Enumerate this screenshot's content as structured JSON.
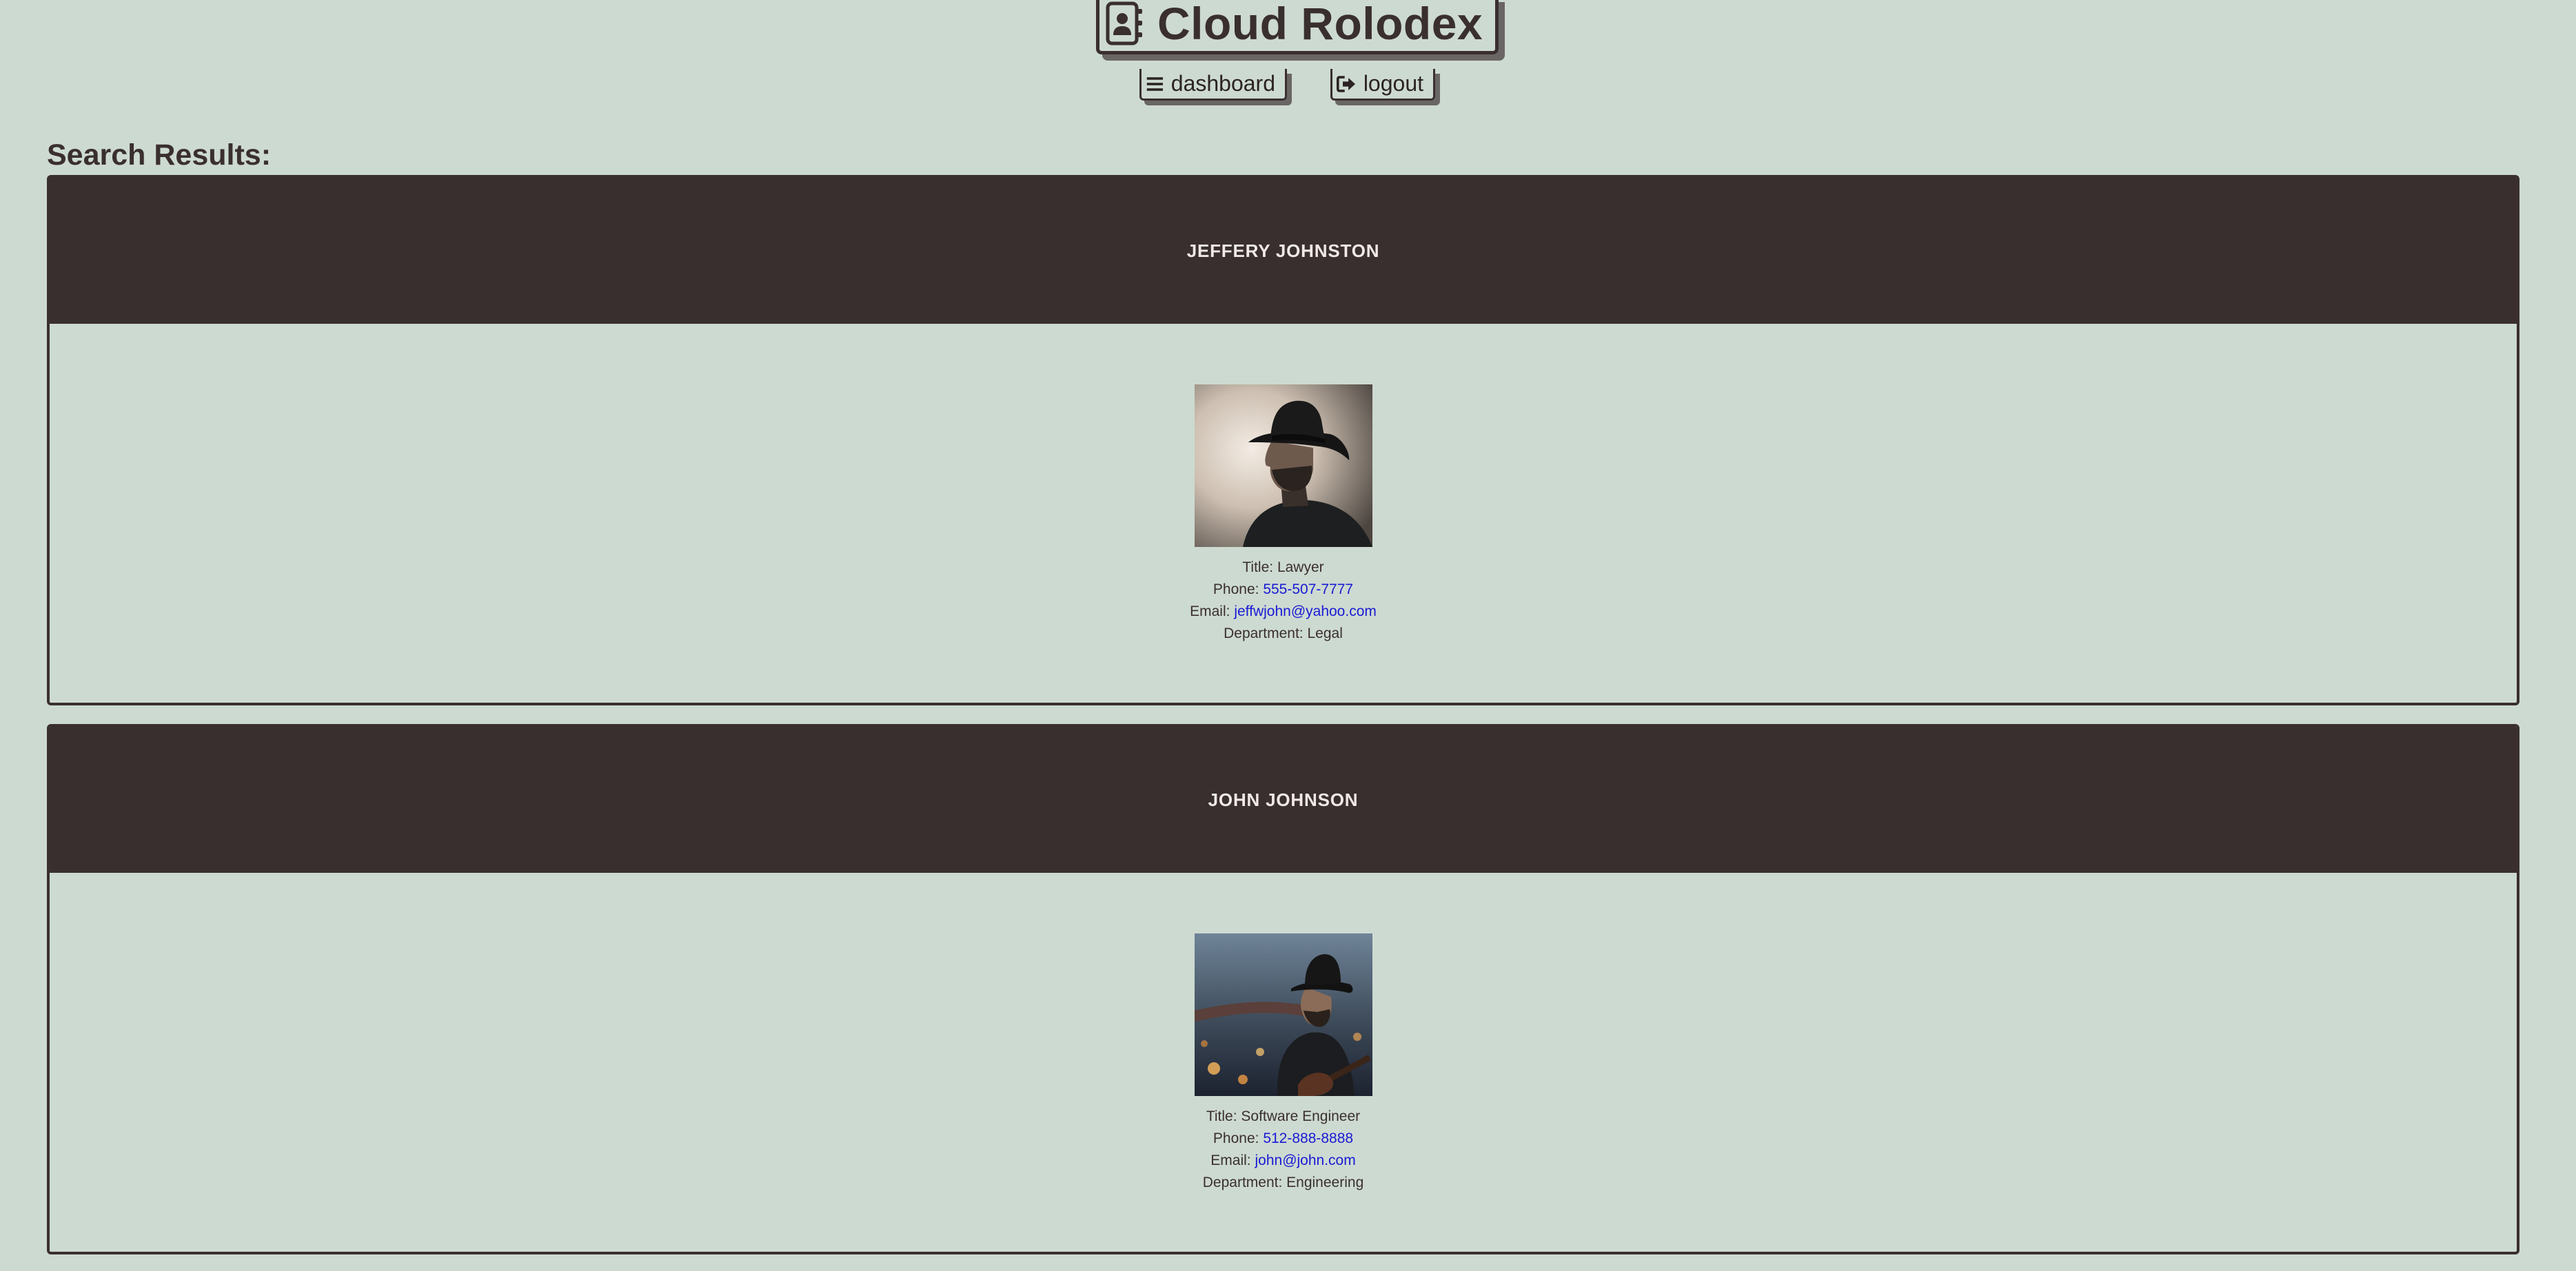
{
  "app": {
    "title": "Cloud Rolodex",
    "icon": "address-book-icon"
  },
  "nav": {
    "dashboard": {
      "label": "dashboard",
      "icon": "bars-icon"
    },
    "logout": {
      "label": "logout",
      "icon": "sign-out-icon"
    }
  },
  "results": {
    "heading": "Search Results:"
  },
  "labels": {
    "title": "Title:",
    "phone": "Phone:",
    "email": "Email:",
    "department": "Department:"
  },
  "contacts": [
    {
      "name": "JEFFERY JOHNSTON",
      "title": "Lawyer",
      "phone": "555-507-7777",
      "email": "jeffwjohn@yahoo.com",
      "department": "Legal",
      "photo": "portrait-cowboy-profile"
    },
    {
      "name": "JOHN JOHNSON",
      "title": "Software Engineer",
      "phone": "512-888-8888",
      "email": "john@john.com",
      "department": "Engineering",
      "photo": "portrait-cowboy-guitar"
    }
  ],
  "colors": {
    "background": "#cddad1",
    "dark": "#3a2f2f",
    "link": "#1a1ad4",
    "header_text": "#efe9e7"
  }
}
